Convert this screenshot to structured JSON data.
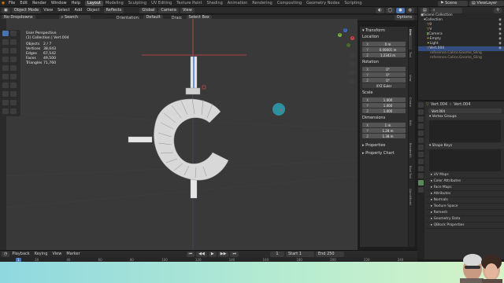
{
  "menu": [
    "File",
    "Edit",
    "Render",
    "Window",
    "Help"
  ],
  "workspaces": [
    "Layout",
    "Modeling",
    "Sculpting",
    "UV Editing",
    "Texture Paint",
    "Shading",
    "Animation",
    "Rendering",
    "Compositing",
    "Geometry Nodes",
    "Scripting"
  ],
  "active_workspace": "Layout",
  "scene_name": "Scene",
  "view_layer": "ViewLayer",
  "viewport_header": {
    "mode": "Object Mode",
    "view": "View",
    "select": "Select",
    "add": "Add",
    "object": "Object",
    "snap": "Reflects",
    "pivot": "Global",
    "camera": "Camera",
    "view2": "View",
    "orientation": "Orientation:",
    "orientation_value": "Default",
    "drag": "Drag:",
    "drag_value": "Select Box",
    "options": "Options",
    "no_dropdowns": "No Dropdowns",
    "search": "Search"
  },
  "stats": {
    "view_name": "User Perspective",
    "collection": "(1) Collection | Vert.004",
    "rows": [
      {
        "k": "Objects",
        "v": "2 / 7"
      },
      {
        "k": "Vertices",
        "v": "38,043"
      },
      {
        "k": "Edges",
        "v": "67,542"
      },
      {
        "k": "Faces",
        "v": "49,500"
      },
      {
        "k": "Triangles",
        "v": "71,760"
      }
    ]
  },
  "npanel": {
    "title": "Transform",
    "location_label": "Location",
    "location": [
      {
        "a": "X",
        "v": "0 m"
      },
      {
        "a": "Y",
        "v": "0.00001 m"
      },
      {
        "a": "Z",
        "v": "1.2343 m"
      }
    ],
    "rotation_label": "Rotation",
    "rotation": [
      {
        "a": "X",
        "v": "0°"
      },
      {
        "a": "Y",
        "v": "0°"
      },
      {
        "a": "Z",
        "v": "0°"
      }
    ],
    "rotation_mode": "XYZ Euler",
    "scale_label": "Scale",
    "scale": [
      {
        "a": "X",
        "v": "1.000"
      },
      {
        "a": "Y",
        "v": "1.000"
      },
      {
        "a": "Z",
        "v": "1.000"
      }
    ],
    "dimensions_label": "Dimensions",
    "dimensions": [
      {
        "a": "X",
        "v": "1 m"
      },
      {
        "a": "Y",
        "v": "1.28 m"
      },
      {
        "a": "Z",
        "v": "1.38 m"
      }
    ],
    "properties": "Properties",
    "property_chart": "Property Chart"
  },
  "vtabs": [
    "Item",
    "Tool",
    "View",
    "Create",
    "Edit",
    "BlenderKit",
    "Bool Tool",
    "QuickModel"
  ],
  "outliner": {
    "title": "Scene Collection",
    "rows": [
      {
        "label": "Collection",
        "sel": false
      },
      {
        "label": "0",
        "sel": false
      },
      {
        "label": "V",
        "sel": false
      },
      {
        "label": "Camera",
        "sel": false
      },
      {
        "label": "Empty",
        "sel": false
      },
      {
        "label": "Light",
        "sel": false
      },
      {
        "label": "Vert.004",
        "sel": true
      },
      {
        "label": "reference.Calico.Gnome_Sling",
        "sel": false
      },
      {
        "label": "reference.Calico.Gnome_Sling",
        "sel": false
      }
    ]
  },
  "properties_panel": {
    "object": "Vert.004",
    "mesh": "Vert.004",
    "data_name": "Vert.004",
    "vertex_groups": "Vertex Groups",
    "shape_keys": "Shape Keys",
    "sections": [
      "UV Maps",
      "Color Attributes",
      "Face Maps",
      "Attributes",
      "Normals",
      "Texture Space",
      "Remesh",
      "Geometry Data",
      "QBlock Properties"
    ]
  },
  "timeline": {
    "playback": "Playback",
    "keying": "Keying",
    "view": "View",
    "marker": "Marker",
    "frame": "1",
    "start_label": "Start",
    "start": "1",
    "end_label": "End",
    "end": "250",
    "ticks": [
      "20",
      "40",
      "60",
      "80",
      "100",
      "120",
      "140",
      "160",
      "180",
      "200",
      "220",
      "240"
    ]
  },
  "colors": {
    "accent": "#4772b3",
    "viewport": "#393939",
    "selected": "#334d80",
    "axis_x": "#d94848",
    "axis_y": "#7bb640",
    "axis_z": "#3d6fd9",
    "cursor": "#2e8fa0"
  }
}
